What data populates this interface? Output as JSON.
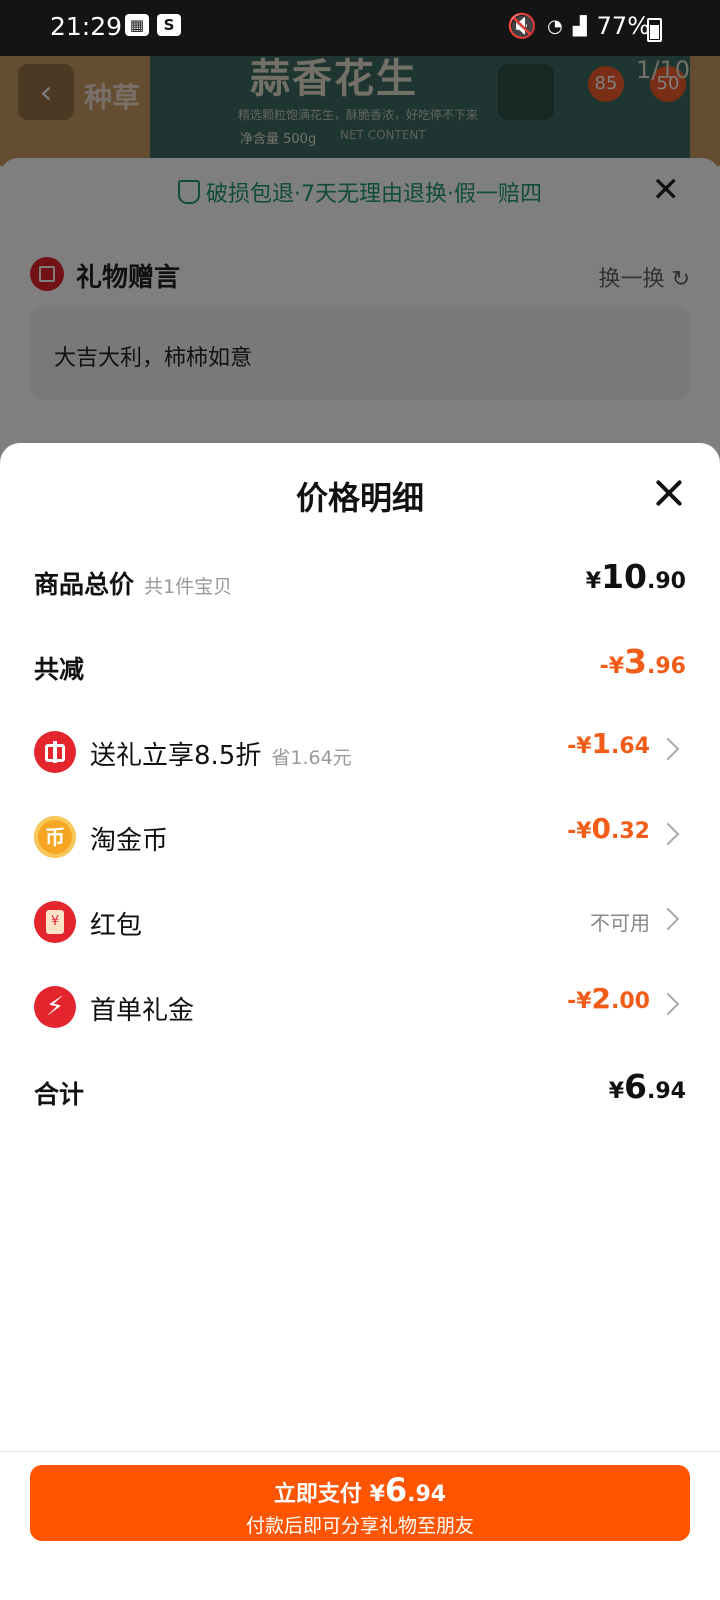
{
  "status_bar": {
    "time": "21:29",
    "battery": "77%",
    "gallery_icon": "image-icon",
    "app_icon": "S"
  },
  "background": {
    "back_icon": "‹",
    "title": "种草",
    "banner_title": "蒜香花生",
    "banner_sub": "精选颗粒饱满花生，酥脆香浓，好吃停不下来",
    "banner_weight": "净含量 500g",
    "banner_net": "NET CONTENT",
    "page_indicator": "1/10",
    "badges": [
      "85",
      "50"
    ],
    "guarantee": "破损包退·7天无理由退换·假一赔四",
    "gift_title": "礼物赠言",
    "swap_label": "换一换",
    "gift_message": "大吉大利，柿柿如意"
  },
  "modal": {
    "title": "价格明细",
    "rows": [
      {
        "label": "商品总价",
        "sub": "共1件宝贝",
        "sym": "¥",
        "int": "10",
        "dec": ".90"
      },
      {
        "label": "共减",
        "sym": "-¥",
        "int": "3",
        "dec": ".96"
      },
      {
        "label": "送礼立享8.5折",
        "sub": "省1.64元",
        "sym": "-¥",
        "int": "1",
        "dec": ".64"
      },
      {
        "label": "淘金币",
        "sym": "-¥",
        "int": "0",
        "dec": ".32",
        "icon_glyph": "币"
      },
      {
        "label": "红包",
        "value_text": "不可用"
      },
      {
        "label": "首单礼金",
        "sym": "-¥",
        "int": "2",
        "dec": ".00",
        "icon_glyph": "⚡"
      },
      {
        "label": "合计",
        "sym": "¥",
        "int": "6",
        "dec": ".94"
      }
    ],
    "pay_button": {
      "label": "立即支付",
      "sym": "¥",
      "int": "6",
      "dec": ".94",
      "subtitle": "付款后即可分享礼物至朋友"
    }
  },
  "colors": {
    "accent": "#ff5500",
    "discount": "#f25c19",
    "guarantee_green": "#1f9a69",
    "icon_red": "#e4252d",
    "coin_gold": "#f6a623"
  }
}
